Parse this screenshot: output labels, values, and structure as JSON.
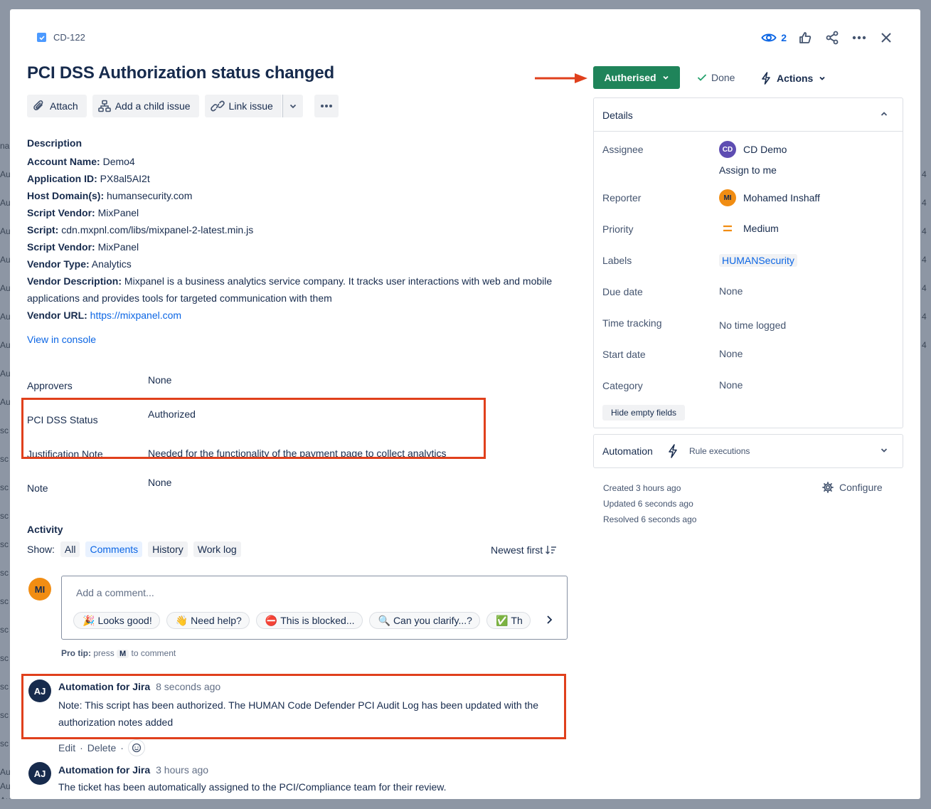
{
  "background": {
    "left_fragments": [
      "nai",
      "Au",
      "Au",
      "Au",
      "Au",
      "Au",
      "Au",
      "Au",
      "Au",
      "Au",
      "sc",
      "sc",
      "sc",
      "sc",
      "sc",
      "sc",
      "sc",
      "sc",
      "sc",
      "sc",
      "sc",
      "sc",
      "Au",
      "Au",
      "Au"
    ],
    "right_fragments": [
      "4",
      "4",
      "4",
      "4",
      "4",
      "4",
      "4"
    ]
  },
  "header": {
    "issue_key": "CD-122",
    "watchers_count": "2",
    "title": "PCI DSS Authorization status changed",
    "icons": [
      "eye-icon",
      "thumbs-up-icon",
      "share-icon",
      "more-icon",
      "close-icon"
    ]
  },
  "toolbar": {
    "attach": "Attach",
    "add_child": "Add a child issue",
    "link_issue": "Link issue"
  },
  "description": {
    "heading": "Description",
    "rows": [
      {
        "label": "Account Name:",
        "value": "Demo4"
      },
      {
        "label": "Application ID:",
        "value": "PX8al5AI2t"
      },
      {
        "label": "Host Domain(s):",
        "value": "humansecurity.com"
      },
      {
        "label": "Script Vendor:",
        "value": "MixPanel"
      },
      {
        "label": "Script:",
        "value": "cdn.mxpnl.com/libs/mixpanel-2-latest.min.js"
      },
      {
        "label": "Script Vendor:",
        "value": "MixPanel"
      },
      {
        "label": "Vendor Type:",
        "value": "Analytics"
      },
      {
        "label": "Vendor Description:",
        "value": "Mixpanel is a business analytics service company. It tracks user interactions with web and mobile applications and provides tools for targeted communication with them"
      },
      {
        "label": "Vendor URL:",
        "value": "https://mixpanel.com"
      }
    ],
    "view_console": "View in console"
  },
  "fields": {
    "approvers_label": "Approvers",
    "approvers_value": "None",
    "pci_label": "PCI DSS Status",
    "pci_value": "Authorized",
    "justification_label": "Justification Note",
    "justification_value": "Needed for the functionality of the payment page to collect analytics",
    "note_label": "Note",
    "note_value": "None"
  },
  "activity": {
    "heading": "Activity",
    "show_label": "Show:",
    "filters": [
      "All",
      "Comments",
      "History",
      "Work log"
    ],
    "active_filter": "Comments",
    "sort": "Newest first",
    "my_avatar": "MI",
    "comment_placeholder": "Add a comment...",
    "quick_replies": [
      {
        "emoji": "🎉",
        "text": "Looks good!"
      },
      {
        "emoji": "👋",
        "text": "Need help?"
      },
      {
        "emoji": "⛔",
        "text": "This is blocked..."
      },
      {
        "emoji": "🔍",
        "text": "Can you clarify...?"
      },
      {
        "emoji": "✅",
        "text": "Th"
      }
    ],
    "protip_prefix": "Pro tip:",
    "protip_press": "press",
    "protip_key": "M",
    "protip_suffix": "to comment",
    "comments": [
      {
        "avatar": "AJ",
        "author": "Automation for Jira",
        "time": "8 seconds ago",
        "body": "Note: This script has been authorized. The HUMAN Code Defender PCI Audit Log has been updated with the authorization notes added",
        "edit": "Edit",
        "delete": "Delete"
      },
      {
        "avatar": "AJ",
        "author": "Automation for Jira",
        "time": "3 hours ago",
        "body": "The ticket has been automatically assigned to the PCI/Compliance team for their review."
      }
    ]
  },
  "status": {
    "current": "Autherised",
    "done": "Done",
    "actions": "Actions",
    "color": "#1f845a"
  },
  "details": {
    "heading": "Details",
    "assignee_label": "Assignee",
    "assignee_initials": "CD",
    "assignee_name": "CD Demo",
    "assign_to_me": "Assign to me",
    "reporter_label": "Reporter",
    "reporter_initials": "MI",
    "reporter_name": "Mohamed Inshaff",
    "priority_label": "Priority",
    "priority_value": "Medium",
    "labels_label": "Labels",
    "labels_value": "HUMANSecurity",
    "due_label": "Due date",
    "due_value": "None",
    "time_label": "Time tracking",
    "time_value": "No time logged",
    "start_label": "Start date",
    "start_value": "None",
    "category_label": "Category",
    "category_value": "None",
    "hide_empty": "Hide empty fields"
  },
  "automation": {
    "heading": "Automation",
    "rule_executions": "Rule executions"
  },
  "meta": {
    "created": "Created 3 hours ago",
    "updated": "Updated 6 seconds ago",
    "resolved": "Resolved 6 seconds ago",
    "configure": "Configure"
  },
  "colors": {
    "highlight": "#e0401c",
    "link": "#0c66e4"
  }
}
